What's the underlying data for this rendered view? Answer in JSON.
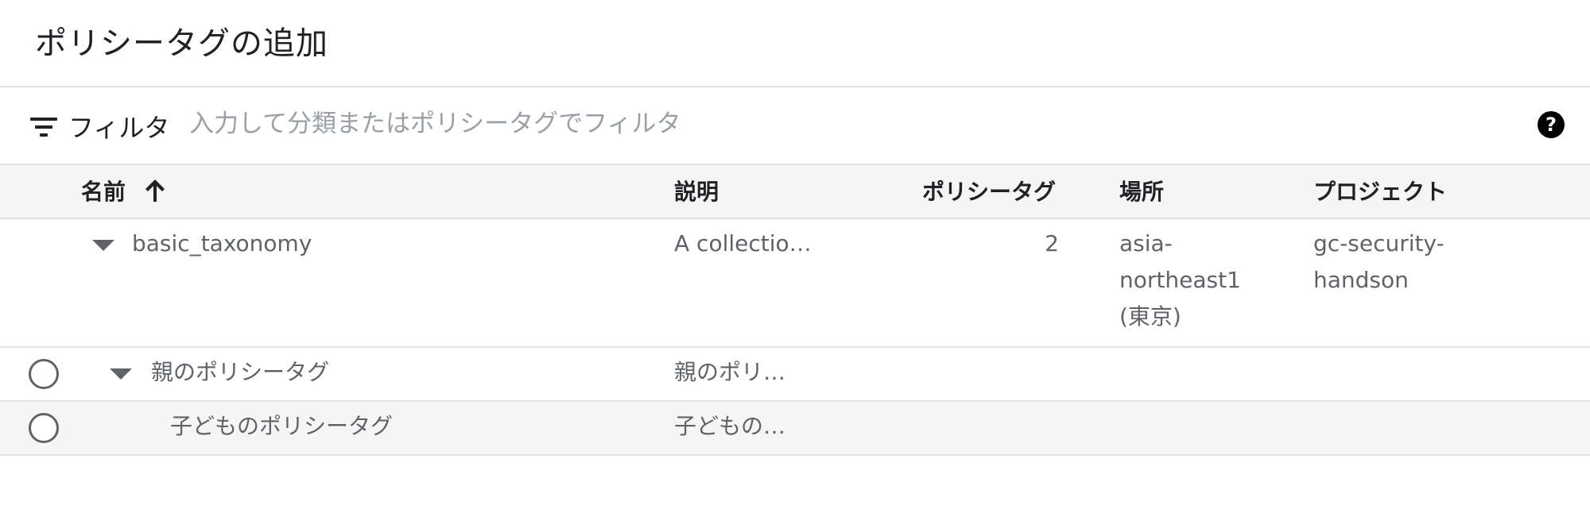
{
  "dialog": {
    "title": "ポリシータグの追加"
  },
  "filter": {
    "label": "フィルタ",
    "placeholder": "入力して分類またはポリシータグでフィルタ",
    "help_icon": "help-circle-icon"
  },
  "table": {
    "columns": {
      "name": "名前",
      "description": "説明",
      "policy_tags": "ポリシータグ",
      "location": "場所",
      "project": "プロジェクト"
    },
    "sort": {
      "column": "name",
      "direction": "ascending",
      "icon": "arrow-up-icon"
    },
    "taxonomy_row": {
      "name": "basic_taxonomy",
      "description": "A collectio…",
      "policy_tags": "2",
      "location_lines": [
        "asia-",
        "northeast1",
        "(東京)"
      ],
      "project_lines": [
        "gc-security-",
        "handson"
      ]
    },
    "parent_row": {
      "name": "親のポリシータグ",
      "description": "親のポリ…",
      "selected": false
    },
    "child_row": {
      "name": "子どものポリシータグ",
      "description": "子どもの…",
      "selected": false
    }
  }
}
